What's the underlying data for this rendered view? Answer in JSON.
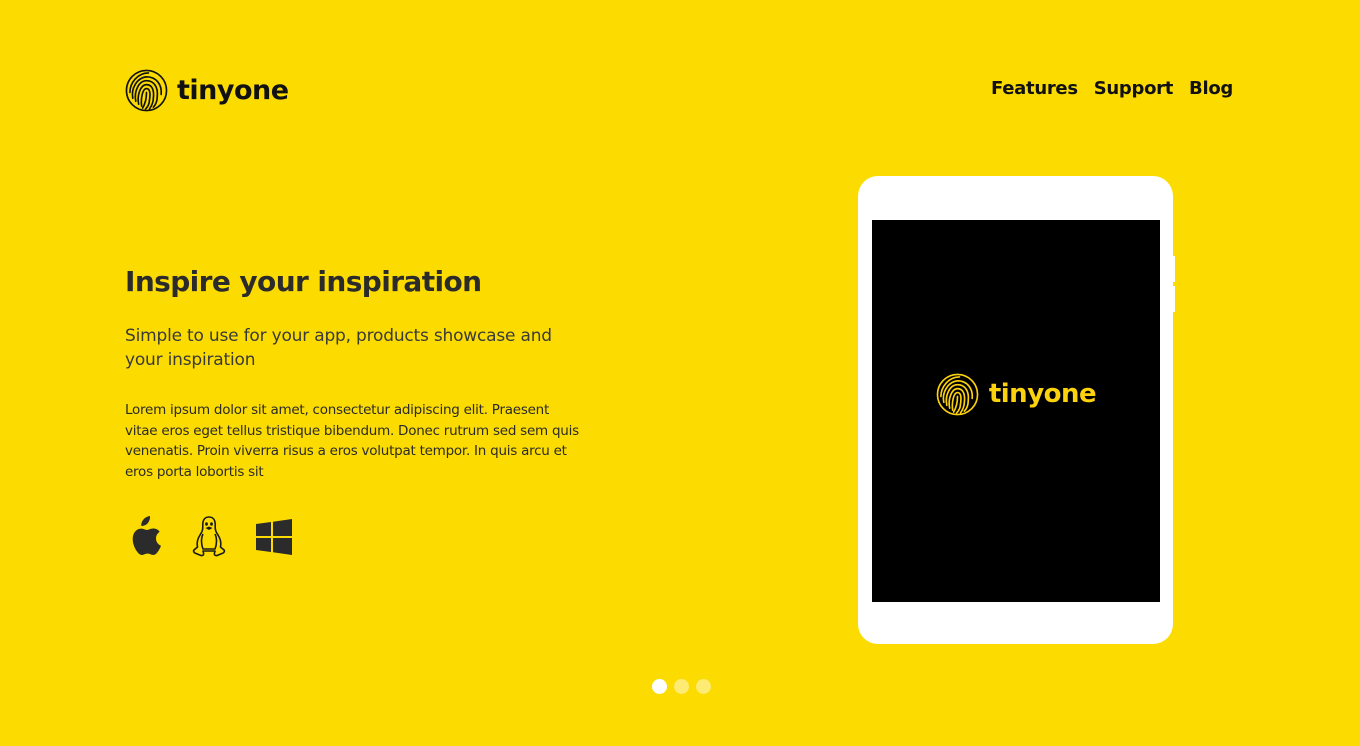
{
  "header": {
    "brand": "tinyone",
    "nav": [
      {
        "label": "Features"
      },
      {
        "label": "Support"
      },
      {
        "label": "Blog"
      }
    ]
  },
  "hero": {
    "title": "Inspire your inspiration",
    "subtitle": "Simple to use for your app, products showcase and your inspiration",
    "body": "Lorem ipsum dolor sit amet, consectetur adipiscing elit. Praesent vitae eros eget tellus tristique bibendum. Donec rutrum sed sem quis venenatis. Proin viverra risus a eros volutpat tempor. In quis arcu et eros porta lobortis sit"
  },
  "platforms": [
    {
      "icon": "apple-icon"
    },
    {
      "icon": "linux-icon"
    },
    {
      "icon": "windows-icon"
    }
  ],
  "device": {
    "screen_brand": "tinyone"
  },
  "slider": {
    "count": 3,
    "active": 0
  },
  "colors": {
    "background": "#fcdb00",
    "text": "#2b2b2b",
    "screen_logo": "#fcd20d"
  }
}
